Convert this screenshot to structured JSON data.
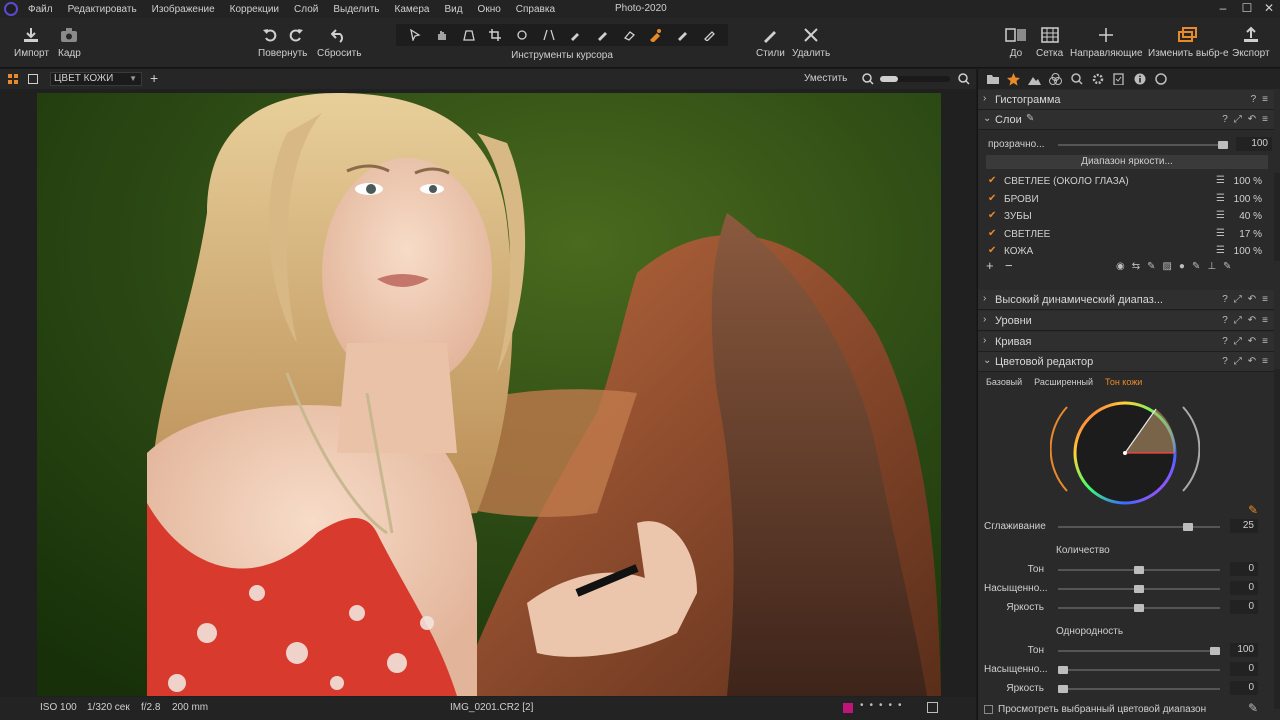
{
  "app": {
    "title": "Photo-2020"
  },
  "menu": [
    "Файл",
    "Редактировать",
    "Изображение",
    "Коррекции",
    "Слой",
    "Выделить",
    "Камера",
    "Вид",
    "Окно",
    "Справка"
  ],
  "window_controls": {
    "minimize": "–",
    "maximize": "☐",
    "close": "✕"
  },
  "toolbar": {
    "import": "Импорт",
    "frame": "Кадр",
    "rotate": "Повернуть",
    "reset": "Сбросить",
    "cursor_tools": "Инструменты курсора",
    "styles": "Стили",
    "delete": "Удалить",
    "before": "До",
    "grid": "Сетка",
    "guides": "Направляющие",
    "edit_selected": "Изменить выбр-е",
    "export": "Экспорт"
  },
  "viewer": {
    "mask_select": "ЦВЕТ КОЖИ",
    "fit": "Уместить",
    "zoom_fraction": 0.25
  },
  "status": {
    "iso": "ISO 100",
    "shutter": "1/320 сек",
    "aperture": "f/2.8",
    "focal": "200 mm",
    "filename": "IMG_0201.CR2 [2]"
  },
  "panel": {
    "histogram": "Гистограмма",
    "layers": {
      "title": "Слои",
      "opacity_label": "прозрачно...",
      "opacity_value": "100",
      "opacity_fraction": 1.0,
      "luma_range": "Диапазон яркости...",
      "items": [
        {
          "name": "СВЕТЛЕЕ (ОКОЛО ГЛАЗА)",
          "pct": "100 %"
        },
        {
          "name": "БРОВИ",
          "pct": "100 %"
        },
        {
          "name": "ЗУБЫ",
          "pct": "40 %"
        },
        {
          "name": "СВЕТЛЕЕ",
          "pct": "17 %"
        },
        {
          "name": "КОЖА",
          "pct": "100 %"
        }
      ]
    },
    "hdr": "Высокий динамический диапаз...",
    "levels": "Уровни",
    "curve": "Кривая",
    "color_editor": {
      "title": "Цветовой редактор",
      "tabs": [
        "Базовый",
        "Расширенный",
        "Тон кожи"
      ],
      "active_tab": 2,
      "smoothing_label": "Сглаживание",
      "smoothing_value": "25",
      "smoothing_fraction": 0.82,
      "amount_heading": "Количество",
      "amount": [
        {
          "label": "Тон",
          "value": "0",
          "fraction": 0.5
        },
        {
          "label": "Насыщенно...",
          "value": "0",
          "fraction": 0.5
        },
        {
          "label": "Яркость",
          "value": "0",
          "fraction": 0.5
        }
      ],
      "uniformity_heading": "Однородность",
      "uniformity": [
        {
          "label": "Тон",
          "value": "100",
          "fraction": 1.0
        },
        {
          "label": "Насыщенно...",
          "value": "0",
          "fraction": 0.0
        },
        {
          "label": "Яркость",
          "value": "0",
          "fraction": 0.0
        }
      ],
      "view_selected": "Просмотреть выбранный цветовой диапазон"
    }
  },
  "colors": {
    "accent": "#e88a2a",
    "panel_bg": "#2a2a2a",
    "toolbar_bg": "#262626"
  }
}
